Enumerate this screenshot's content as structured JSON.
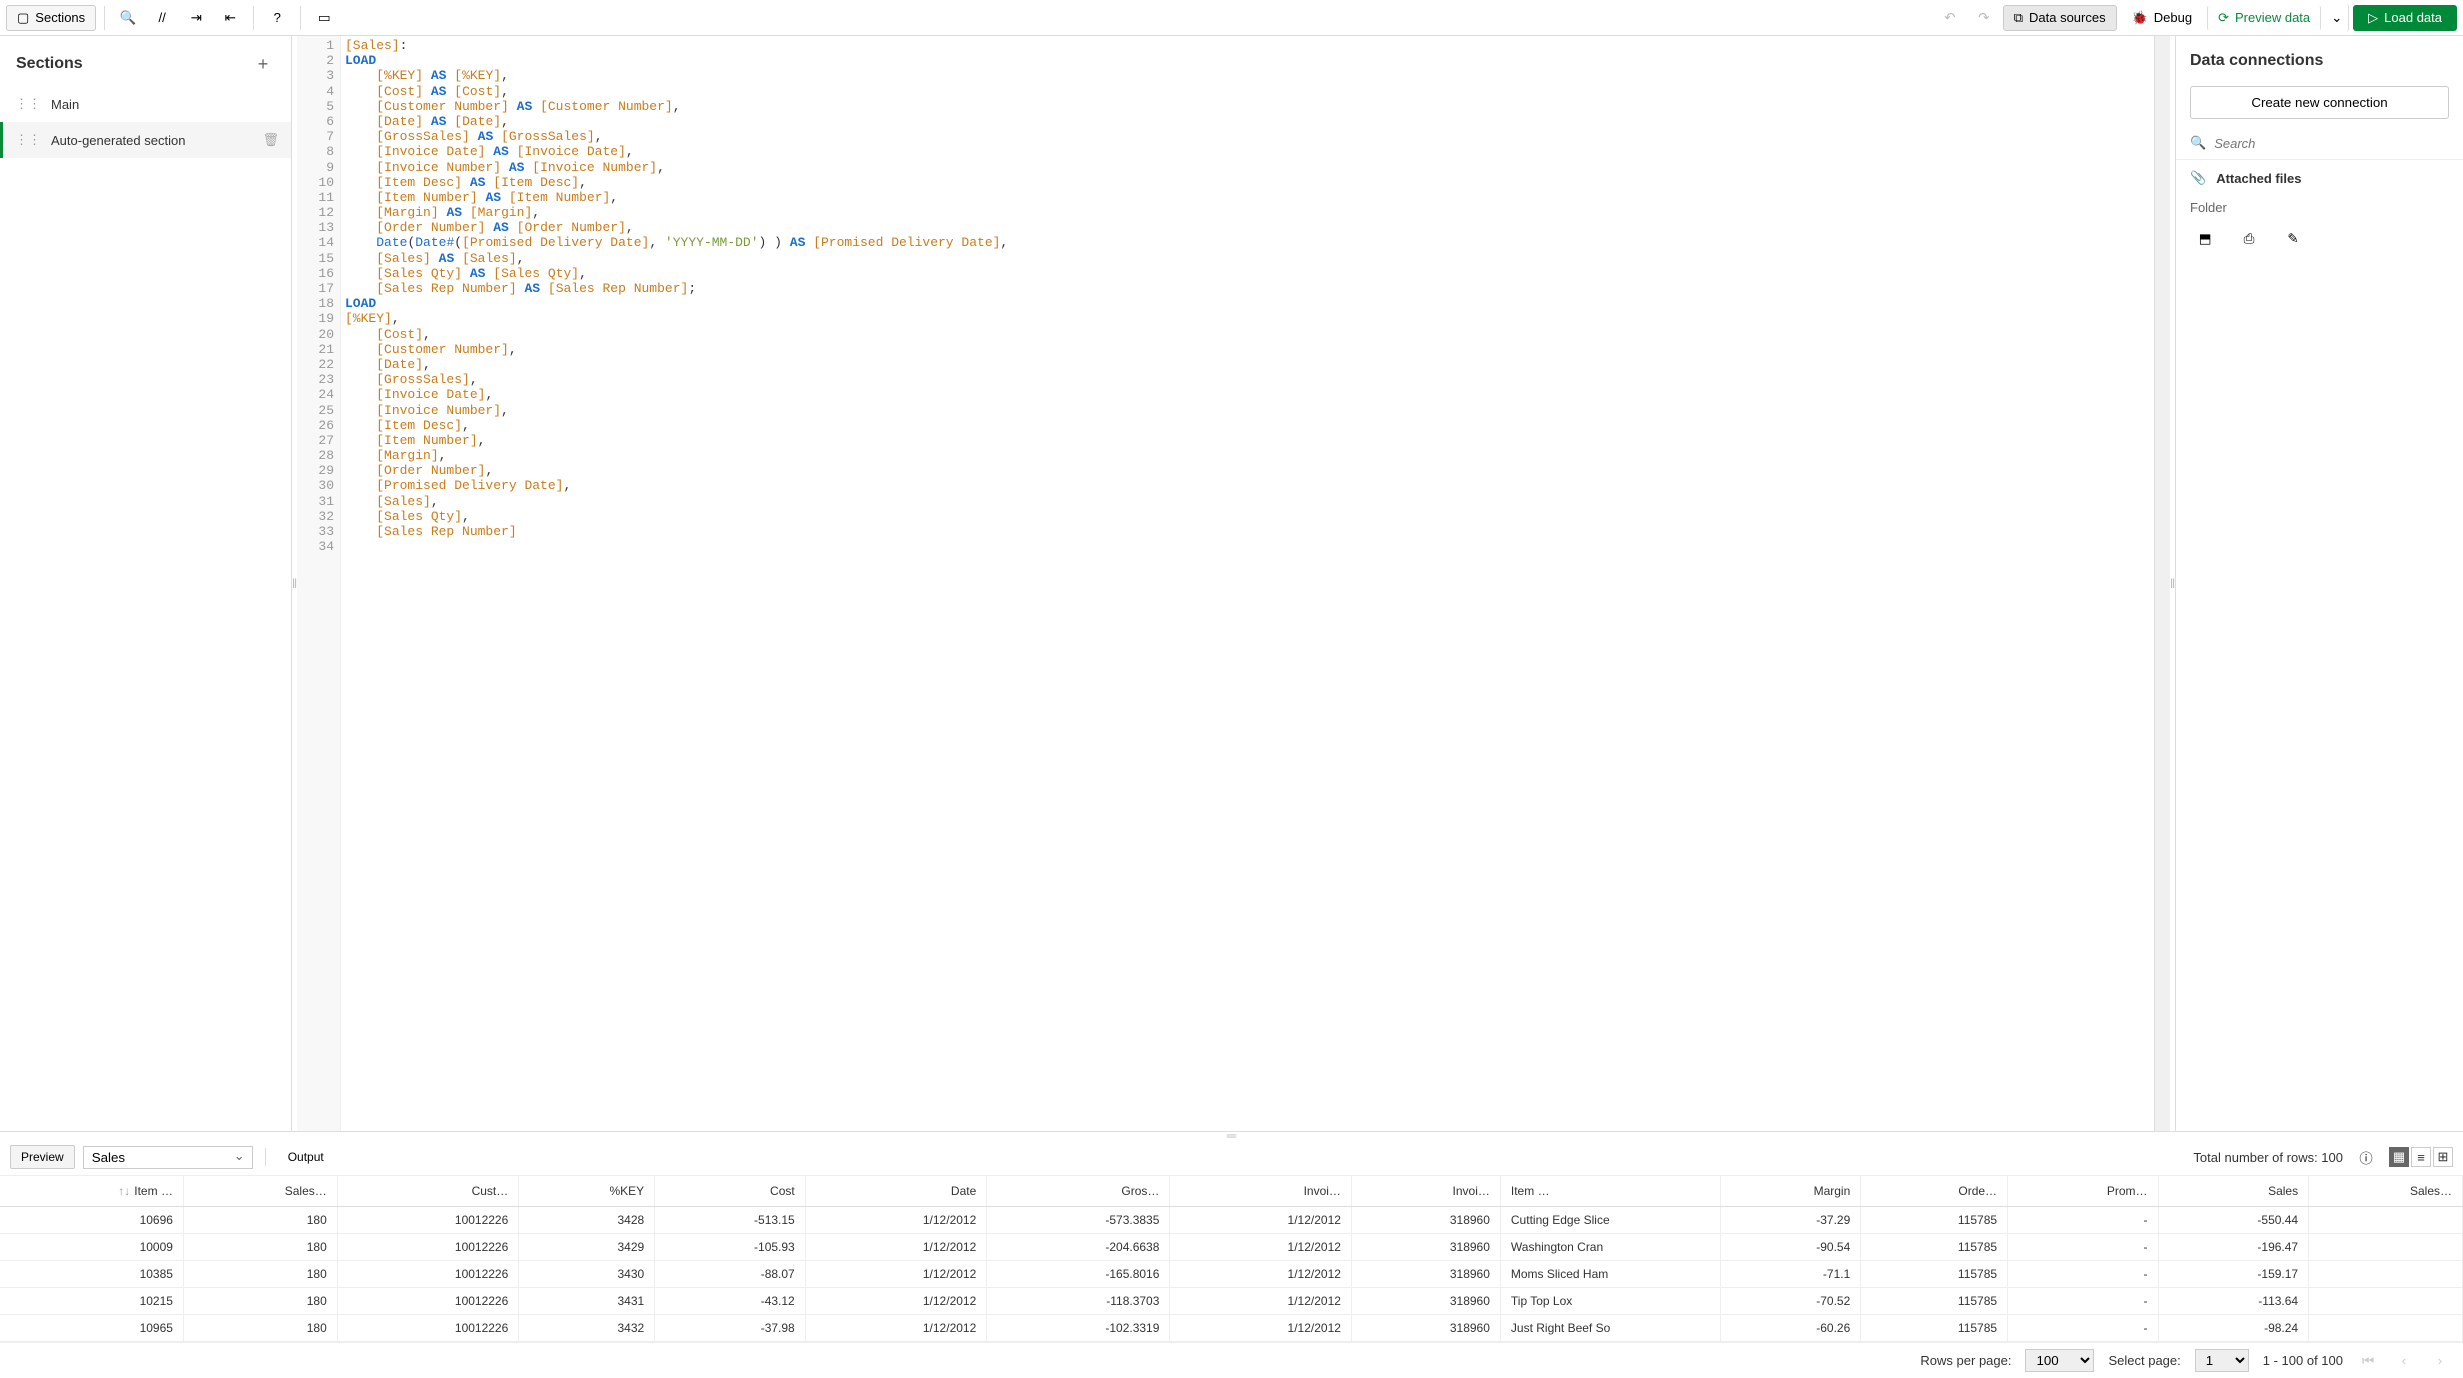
{
  "toolbar": {
    "sections_label": "Sections",
    "data_sources_label": "Data sources",
    "debug_label": "Debug",
    "preview_data_label": "Preview data",
    "load_data_label": "Load data"
  },
  "sections_panel": {
    "title": "Sections",
    "items": [
      {
        "label": "Main",
        "active": false
      },
      {
        "label": "Auto-generated section",
        "active": true
      }
    ]
  },
  "editor": {
    "lines": [
      [
        {
          "t": "[Sales]",
          "c": "tok-br"
        },
        {
          "t": ":"
        }
      ],
      [
        {
          "t": "LOAD",
          "c": "tok-kw"
        }
      ],
      [
        {
          "t": "    "
        },
        {
          "t": "[%KEY]",
          "c": "tok-br"
        },
        {
          "t": " "
        },
        {
          "t": "AS",
          "c": "tok-kw"
        },
        {
          "t": " "
        },
        {
          "t": "[%KEY]",
          "c": "tok-br"
        },
        {
          "t": ","
        }
      ],
      [
        {
          "t": "    "
        },
        {
          "t": "[Cost]",
          "c": "tok-br"
        },
        {
          "t": " "
        },
        {
          "t": "AS",
          "c": "tok-kw"
        },
        {
          "t": " "
        },
        {
          "t": "[Cost]",
          "c": "tok-br"
        },
        {
          "t": ","
        }
      ],
      [
        {
          "t": "    "
        },
        {
          "t": "[Customer Number]",
          "c": "tok-br"
        },
        {
          "t": " "
        },
        {
          "t": "AS",
          "c": "tok-kw"
        },
        {
          "t": " "
        },
        {
          "t": "[Customer Number]",
          "c": "tok-br"
        },
        {
          "t": ","
        }
      ],
      [
        {
          "t": "    "
        },
        {
          "t": "[Date]",
          "c": "tok-br"
        },
        {
          "t": " "
        },
        {
          "t": "AS",
          "c": "tok-kw"
        },
        {
          "t": " "
        },
        {
          "t": "[Date]",
          "c": "tok-br"
        },
        {
          "t": ","
        }
      ],
      [
        {
          "t": "    "
        },
        {
          "t": "[GrossSales]",
          "c": "tok-br"
        },
        {
          "t": " "
        },
        {
          "t": "AS",
          "c": "tok-kw"
        },
        {
          "t": " "
        },
        {
          "t": "[GrossSales]",
          "c": "tok-br"
        },
        {
          "t": ","
        }
      ],
      [
        {
          "t": "    "
        },
        {
          "t": "[Invoice Date]",
          "c": "tok-br"
        },
        {
          "t": " "
        },
        {
          "t": "AS",
          "c": "tok-kw"
        },
        {
          "t": " "
        },
        {
          "t": "[Invoice Date]",
          "c": "tok-br"
        },
        {
          "t": ","
        }
      ],
      [
        {
          "t": "    "
        },
        {
          "t": "[Invoice Number]",
          "c": "tok-br"
        },
        {
          "t": " "
        },
        {
          "t": "AS",
          "c": "tok-kw"
        },
        {
          "t": " "
        },
        {
          "t": "[Invoice Number]",
          "c": "tok-br"
        },
        {
          "t": ","
        }
      ],
      [
        {
          "t": "    "
        },
        {
          "t": "[Item Desc]",
          "c": "tok-br"
        },
        {
          "t": " "
        },
        {
          "t": "AS",
          "c": "tok-kw"
        },
        {
          "t": " "
        },
        {
          "t": "[Item Desc]",
          "c": "tok-br"
        },
        {
          "t": ","
        }
      ],
      [
        {
          "t": "    "
        },
        {
          "t": "[Item Number]",
          "c": "tok-br"
        },
        {
          "t": " "
        },
        {
          "t": "AS",
          "c": "tok-kw"
        },
        {
          "t": " "
        },
        {
          "t": "[Item Number]",
          "c": "tok-br"
        },
        {
          "t": ","
        }
      ],
      [
        {
          "t": "    "
        },
        {
          "t": "[Margin]",
          "c": "tok-br"
        },
        {
          "t": " "
        },
        {
          "t": "AS",
          "c": "tok-kw"
        },
        {
          "t": " "
        },
        {
          "t": "[Margin]",
          "c": "tok-br"
        },
        {
          "t": ","
        }
      ],
      [
        {
          "t": "    "
        },
        {
          "t": "[Order Number]",
          "c": "tok-br"
        },
        {
          "t": " "
        },
        {
          "t": "AS",
          "c": "tok-kw"
        },
        {
          "t": " "
        },
        {
          "t": "[Order Number]",
          "c": "tok-br"
        },
        {
          "t": ","
        }
      ],
      [
        {
          "t": "    "
        },
        {
          "t": "Date",
          "c": "tok-fn"
        },
        {
          "t": "("
        },
        {
          "t": "Date#",
          "c": "tok-fn"
        },
        {
          "t": "("
        },
        {
          "t": "[Promised Delivery Date]",
          "c": "tok-br"
        },
        {
          "t": ", "
        },
        {
          "t": "'YYYY-MM-DD'",
          "c": "tok-str"
        },
        {
          "t": ") ) "
        },
        {
          "t": "AS",
          "c": "tok-kw"
        },
        {
          "t": " "
        },
        {
          "t": "[Promised Delivery Date]",
          "c": "tok-br"
        },
        {
          "t": ","
        }
      ],
      [
        {
          "t": "    "
        },
        {
          "t": "[Sales]",
          "c": "tok-br"
        },
        {
          "t": " "
        },
        {
          "t": "AS",
          "c": "tok-kw"
        },
        {
          "t": " "
        },
        {
          "t": "[Sales]",
          "c": "tok-br"
        },
        {
          "t": ","
        }
      ],
      [
        {
          "t": "    "
        },
        {
          "t": "[Sales Qty]",
          "c": "tok-br"
        },
        {
          "t": " "
        },
        {
          "t": "AS",
          "c": "tok-kw"
        },
        {
          "t": " "
        },
        {
          "t": "[Sales Qty]",
          "c": "tok-br"
        },
        {
          "t": ","
        }
      ],
      [
        {
          "t": "    "
        },
        {
          "t": "[Sales Rep Number]",
          "c": "tok-br"
        },
        {
          "t": " "
        },
        {
          "t": "AS",
          "c": "tok-kw"
        },
        {
          "t": " "
        },
        {
          "t": "[Sales Rep Number]",
          "c": "tok-br"
        },
        {
          "t": ";"
        }
      ],
      [
        {
          "t": "LOAD",
          "c": "tok-kw"
        }
      ],
      [
        {
          "t": "[%KEY]",
          "c": "tok-br"
        },
        {
          "t": ","
        }
      ],
      [
        {
          "t": "    "
        },
        {
          "t": "[Cost]",
          "c": "tok-br"
        },
        {
          "t": ","
        }
      ],
      [
        {
          "t": "    "
        },
        {
          "t": "[Customer Number]",
          "c": "tok-br"
        },
        {
          "t": ","
        }
      ],
      [
        {
          "t": "    "
        },
        {
          "t": "[Date]",
          "c": "tok-br"
        },
        {
          "t": ","
        }
      ],
      [
        {
          "t": "    "
        },
        {
          "t": "[GrossSales]",
          "c": "tok-br"
        },
        {
          "t": ","
        }
      ],
      [
        {
          "t": "    "
        },
        {
          "t": "[Invoice Date]",
          "c": "tok-br"
        },
        {
          "t": ","
        }
      ],
      [
        {
          "t": "    "
        },
        {
          "t": "[Invoice Number]",
          "c": "tok-br"
        },
        {
          "t": ","
        }
      ],
      [
        {
          "t": "    "
        },
        {
          "t": "[Item Desc]",
          "c": "tok-br"
        },
        {
          "t": ","
        }
      ],
      [
        {
          "t": "    "
        },
        {
          "t": "[Item Number]",
          "c": "tok-br"
        },
        {
          "t": ","
        }
      ],
      [
        {
          "t": "    "
        },
        {
          "t": "[Margin]",
          "c": "tok-br"
        },
        {
          "t": ","
        }
      ],
      [
        {
          "t": "    "
        },
        {
          "t": "[Order Number]",
          "c": "tok-br"
        },
        {
          "t": ","
        }
      ],
      [
        {
          "t": "    "
        },
        {
          "t": "[Promised Delivery Date]",
          "c": "tok-br"
        },
        {
          "t": ","
        }
      ],
      [
        {
          "t": "    "
        },
        {
          "t": "[Sales]",
          "c": "tok-br"
        },
        {
          "t": ","
        }
      ],
      [
        {
          "t": "    "
        },
        {
          "t": "[Sales Qty]",
          "c": "tok-br"
        },
        {
          "t": ","
        }
      ],
      [
        {
          "t": "    "
        },
        {
          "t": "[Sales Rep Number]",
          "c": "tok-br"
        }
      ],
      [
        {
          "t": ""
        }
      ]
    ]
  },
  "connections": {
    "title": "Data connections",
    "create_label": "Create new connection",
    "search_placeholder": "Search",
    "attached_label": "Attached files",
    "folder_label": "Folder"
  },
  "preview": {
    "tab_preview": "Preview",
    "select_value": "Sales",
    "tab_output": "Output",
    "total_label": "Total number of rows: 100",
    "columns": [
      "Item …",
      "Sales…",
      "Cust…",
      "%KEY",
      "Cost",
      "Date",
      "Gros…",
      "Invoi…",
      "Invoi…",
      "Item …",
      "Margin",
      "Orde…",
      "Prom…",
      "Sales",
      "Sales…"
    ],
    "rows": [
      [
        "10696",
        "180",
        "10012226",
        "3428",
        "-513.15",
        "1/12/2012",
        "-573.3835",
        "1/12/2012",
        "318960",
        "Cutting Edge Slice",
        "-37.29",
        "115785",
        "-",
        "-550.44",
        ""
      ],
      [
        "10009",
        "180",
        "10012226",
        "3429",
        "-105.93",
        "1/12/2012",
        "-204.6638",
        "1/12/2012",
        "318960",
        "Washington Cran",
        "-90.54",
        "115785",
        "-",
        "-196.47",
        ""
      ],
      [
        "10385",
        "180",
        "10012226",
        "3430",
        "-88.07",
        "1/12/2012",
        "-165.8016",
        "1/12/2012",
        "318960",
        "Moms Sliced Ham",
        "-71.1",
        "115785",
        "-",
        "-159.17",
        ""
      ],
      [
        "10215",
        "180",
        "10012226",
        "3431",
        "-43.12",
        "1/12/2012",
        "-118.3703",
        "1/12/2012",
        "318960",
        "Tip Top Lox",
        "-70.52",
        "115785",
        "-",
        "-113.64",
        ""
      ],
      [
        "10965",
        "180",
        "10012226",
        "3432",
        "-37.98",
        "1/12/2012",
        "-102.3319",
        "1/12/2012",
        "318960",
        "Just Right Beef So",
        "-60.26",
        "115785",
        "-",
        "-98.24",
        ""
      ]
    ],
    "text_col_index": 9
  },
  "pagination": {
    "rows_per_page_label": "Rows per page:",
    "rows_per_page_value": "100",
    "select_page_label": "Select page:",
    "select_page_value": "1",
    "range_label": "1 - 100 of 100"
  }
}
